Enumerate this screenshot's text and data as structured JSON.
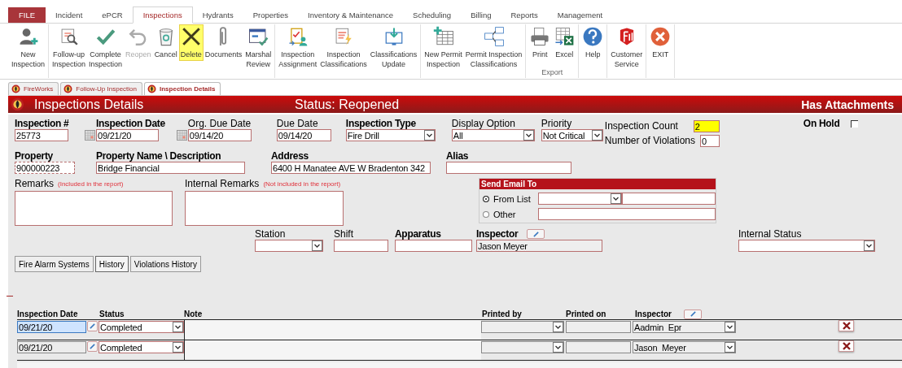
{
  "ribbon_tabs": [
    {
      "label": "FILE",
      "kind": "file",
      "selected": false
    },
    {
      "label": "Incident",
      "kind": "tab",
      "selected": false
    },
    {
      "label": "ePCR",
      "kind": "tab",
      "selected": false
    },
    {
      "label": "Inspections",
      "kind": "tab",
      "selected": true
    },
    {
      "label": "Hydrants",
      "kind": "tab",
      "selected": false
    },
    {
      "label": "Properties",
      "kind": "tab",
      "selected": false
    },
    {
      "label": "Inventory & Maintenance",
      "kind": "tab",
      "selected": false
    },
    {
      "label": "Scheduling",
      "kind": "tab",
      "selected": false
    },
    {
      "label": "Billing",
      "kind": "tab",
      "selected": false
    },
    {
      "label": "Reports",
      "kind": "tab",
      "selected": false
    },
    {
      "label": "Management",
      "kind": "tab",
      "selected": false
    }
  ],
  "ribbon_groups": [
    {
      "buttons": [
        {
          "label": "New\nInspection",
          "disabled": false,
          "selected": false
        }
      ]
    },
    {
      "buttons": [
        {
          "label": "Follow-up\nInspection",
          "disabled": false,
          "selected": false
        },
        {
          "label": "Complete\nInspection",
          "disabled": false,
          "selected": false
        },
        {
          "label": "Reopen",
          "disabled": true,
          "selected": false
        },
        {
          "label": "Cancel",
          "disabled": false,
          "selected": false
        },
        {
          "label": "Delete",
          "disabled": false,
          "selected": true
        },
        {
          "label": "Documents",
          "disabled": false,
          "selected": false
        },
        {
          "label": "Marshal\nReview",
          "disabled": false,
          "selected": false
        }
      ]
    },
    {
      "buttons": [
        {
          "label": "Inspection\nAssignment",
          "disabled": false,
          "selected": false
        },
        {
          "label": "Inspection\nClassifications",
          "disabled": false,
          "selected": false
        },
        {
          "label": "Classifications\nUpdate",
          "disabled": false,
          "selected": false
        }
      ]
    },
    {
      "buttons": [
        {
          "label": "New Permit\nInspection",
          "disabled": false,
          "selected": false
        },
        {
          "label": "Permit Inspection\nClassifications",
          "disabled": false,
          "selected": false
        }
      ]
    },
    {
      "label": "Export",
      "buttons": [
        {
          "label": "Print",
          "disabled": false,
          "selected": false
        },
        {
          "label": "Excel",
          "disabled": false,
          "selected": false
        }
      ]
    },
    {
      "buttons": [
        {
          "label": "Help",
          "disabled": false,
          "selected": false
        }
      ]
    },
    {
      "buttons": [
        {
          "label": "Customer\nService",
          "disabled": false,
          "selected": false
        }
      ]
    },
    {
      "buttons": [
        {
          "label": "EXIT",
          "disabled": false,
          "selected": false
        }
      ]
    }
  ],
  "doc_tabs": [
    {
      "label": "FireWorks",
      "selected": false
    },
    {
      "label": "Follow-Up Inspection",
      "selected": false
    },
    {
      "label": "Inspection Details",
      "selected": true
    }
  ],
  "header": {
    "title": "Inspections Details",
    "status": "Status: Reopened",
    "attachments": "Has Attachments"
  },
  "form": {
    "inspection_number": {
      "label": "Inspection #",
      "value": "25773"
    },
    "inspection_date": {
      "label": "Inspection Date",
      "value": "09/21/20"
    },
    "org_due_date": {
      "label": "Org. Due Date",
      "value": "09/14/20"
    },
    "due_date": {
      "label": "Due Date",
      "value": "09/14/20"
    },
    "inspection_type": {
      "label": "Inspection Type",
      "value": "Fire Drill"
    },
    "display_option": {
      "label": "Display Option",
      "value": "All"
    },
    "priority": {
      "label": "Priority",
      "value": "Not Critical"
    },
    "inspection_count": {
      "label": "Inspection Count",
      "value": "2"
    },
    "number_of_violations": {
      "label": "Number of Violations",
      "value": "0"
    },
    "on_hold": {
      "label": "On Hold",
      "checked": false
    },
    "property": {
      "label": "Property",
      "value": "900000223"
    },
    "property_name": {
      "label": "Property Name \\ Description",
      "value": "Bridge Financial"
    },
    "address": {
      "label": "Address",
      "value": "6400 H Manatee AVE W Bradenton 342"
    },
    "alias": {
      "label": "Alias"
    },
    "remarks": {
      "label": "Remarks",
      "note": "(Included in the report)"
    },
    "internal_remarks": {
      "label": "Internal Remarks",
      "note": "(Not included in the report)"
    },
    "station": {
      "label": "Station"
    },
    "shift": {
      "label": "Shift"
    },
    "apparatus": {
      "label": "Apparatus"
    },
    "inspector": {
      "label": "Inspector",
      "value": "Jason Meyer"
    },
    "internal_status": {
      "label": "Internal Status"
    }
  },
  "email": {
    "title": "Send Email To",
    "options": [
      {
        "label": "From List",
        "selected": true
      },
      {
        "label": "Other",
        "selected": false
      }
    ]
  },
  "subtabs": [
    {
      "label": "Fire Alarm Systems",
      "selected": false
    },
    {
      "label": "History",
      "selected": true
    },
    {
      "label": "Violations History",
      "selected": false
    }
  ],
  "history": {
    "columns": [
      "Inspection Date",
      "Status",
      "Note",
      "Printed by",
      "Printed on",
      "Inspector"
    ],
    "rows": [
      {
        "inspection_date": "09/21/20",
        "status": "Completed",
        "inspector": "Aadmin  Epr",
        "selected": true
      },
      {
        "inspection_date": "09/21/20",
        "status": "Completed",
        "inspector": "Jason  Meyer",
        "selected": false
      }
    ]
  }
}
